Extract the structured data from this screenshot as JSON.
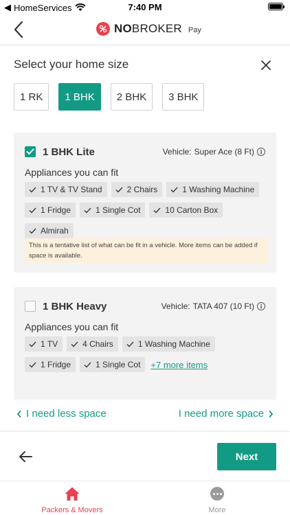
{
  "status_bar": {
    "carrier": "HomeServices",
    "time": "7:40 PM"
  },
  "header": {
    "logo_bold": "NO",
    "logo_regular": "BROKER",
    "logo_suffix": "Pay"
  },
  "section_title": "Select your home size",
  "sizes": [
    {
      "label": "1 RK",
      "selected": false
    },
    {
      "label": "1 BHK",
      "selected": true
    },
    {
      "label": "2 BHK",
      "selected": false
    },
    {
      "label": "3 BHK",
      "selected": false
    }
  ],
  "plans": [
    {
      "title": "1 BHK Lite",
      "checked": true,
      "vehicle_label": "Vehicle:",
      "vehicle": "Super Ace (8 Ft)",
      "fit_title": "Appliances you can fit",
      "items": [
        "1 TV & TV Stand",
        "2 Chairs",
        "1 Washing Machine",
        "1 Fridge",
        "1 Single Cot",
        "10 Carton Box",
        "Almirah"
      ],
      "note": "This is a tentative list of what can be fit in a vehicle. More items can be added if space is available."
    },
    {
      "title": "1 BHK Heavy",
      "checked": false,
      "vehicle_label": "Vehicle:",
      "vehicle": "TATA 407 (10 Ft)",
      "fit_title": "Appliances you can fit",
      "items": [
        "1 TV",
        "4 Chairs",
        "1 Washing Machine",
        "1 Fridge",
        "1 Single Cot"
      ],
      "more_items": "+7 more items"
    }
  ],
  "space_links": {
    "less": "I need less space",
    "more": "I need more space"
  },
  "bottom": {
    "next": "Next"
  },
  "tabs": [
    {
      "label": "Packers & Movers",
      "icon": "home-icon",
      "active": true
    },
    {
      "label": "More",
      "icon": "more-icon",
      "active": false
    }
  ],
  "colors": {
    "accent": "#139a85",
    "brand": "#e7424f",
    "note_bg": "#fdf0dc"
  }
}
